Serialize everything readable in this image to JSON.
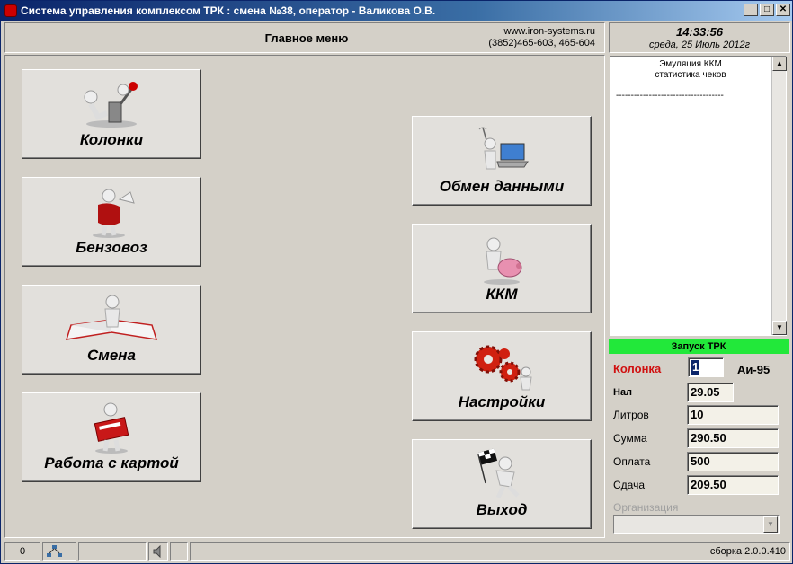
{
  "window": {
    "title": "Система управления комплексом ТРК : смена №38, оператор - Валикова О.В.",
    "buttons": {
      "minimize": "_",
      "maximize": "□",
      "close": "✕"
    }
  },
  "header": {
    "title": "Главное меню",
    "site": "www.iron-systems.ru",
    "phones": "(3852)465-603, 465-604"
  },
  "clock": {
    "time": "14:33:56",
    "date": "среда, 25 Июль 2012г"
  },
  "menu": {
    "pumps": "Колонки",
    "tanker": "Бензовоз",
    "shift": "Смена",
    "card": "Работа с картой",
    "exchange": "Обмен данными",
    "kkm": "ККМ",
    "settings": "Настройки",
    "exit": "Выход"
  },
  "log": {
    "line1": "Эмуляция ККМ",
    "line2": "статистика чеков",
    "separator": "------------------------------------"
  },
  "trk": {
    "header": "Запуск ТРК",
    "pump_label": "Колонка",
    "pump_value": "1",
    "fuel": "Аи-95",
    "cash_label": "Нал",
    "cash_value": "29.05",
    "liters_label": "Литров",
    "liters_value": "10",
    "sum_label": "Сумма",
    "sum_value": "290.50",
    "paid_label": "Оплата",
    "paid_value": "500",
    "change_label": "Сдача",
    "change_value": "209.50",
    "org_label": "Организация",
    "org_value": ""
  },
  "status": {
    "counter": "0",
    "build": "сборка 2.0.0.410"
  },
  "colors": {
    "titlebar": "#0a246a",
    "trk_header": "#22e83a",
    "pump_label": "#d01010"
  }
}
